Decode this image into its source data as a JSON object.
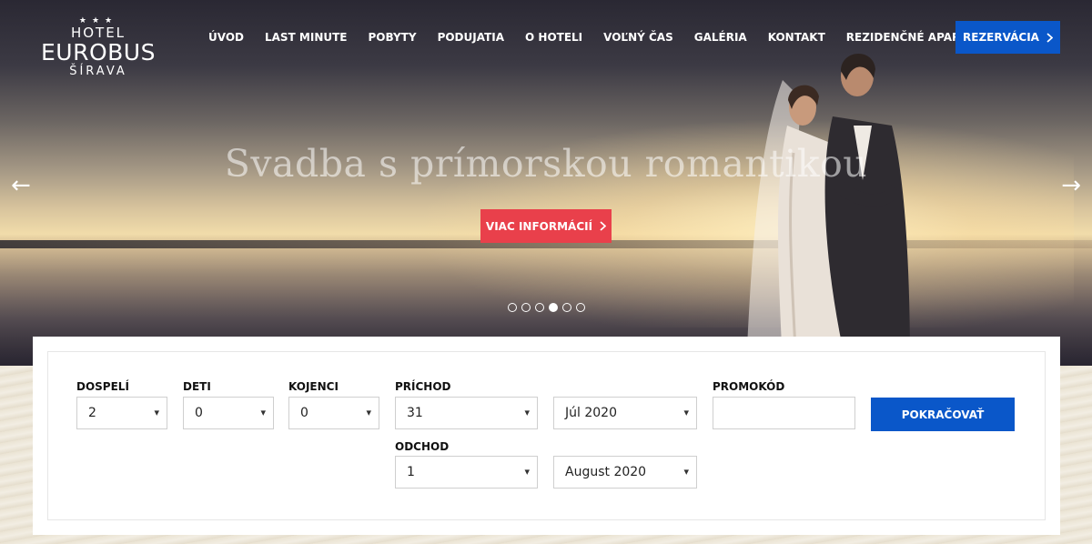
{
  "logo": {
    "stars": "★★★",
    "hotel": "HOTEL",
    "brand": "EUROBUS",
    "place": "ŠÍRAVA"
  },
  "nav": {
    "items": [
      "ÚVOD",
      "LAST MINUTE",
      "POBYTY",
      "PODUJATIA",
      "O HOTELI",
      "VOĽNÝ ČAS",
      "GALÉRIA",
      "KONTAKT",
      "REZIDENČNÉ APARTMÁNY"
    ],
    "reserve_label": "REZERVÁCIA",
    "reserve_icon": "chevron-right-icon"
  },
  "hero": {
    "title": "Svadba s prímorskou romantikou",
    "button_label": "VIAC INFORMÁCIÍ",
    "prev_arrow": "←",
    "next_arrow": "→",
    "slide_count": 6,
    "active_slide": 4
  },
  "booking": {
    "adults": {
      "label": "DOSPELÍ",
      "value": "2"
    },
    "children": {
      "label": "DETI",
      "value": "0"
    },
    "infants": {
      "label": "KOJENCI",
      "value": "0"
    },
    "arrival": {
      "label": "PRÍCHOD",
      "day": "31",
      "month": "Júl 2020"
    },
    "departure": {
      "label": "ODCHOD",
      "day": "1",
      "month": "August 2020"
    },
    "promo": {
      "label": "PROMOKÓD",
      "value": "",
      "placeholder": ""
    },
    "continue_label": "POKRAČOVAŤ"
  },
  "colors": {
    "primary_blue": "#0a57c9",
    "accent_red": "#e9404b"
  }
}
